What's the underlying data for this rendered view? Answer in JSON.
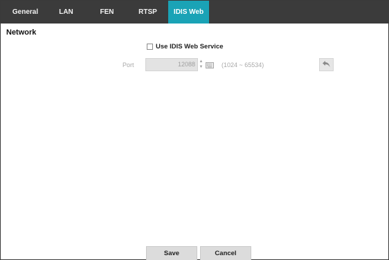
{
  "tabs": [
    {
      "label": "General",
      "active": false
    },
    {
      "label": "LAN",
      "active": false
    },
    {
      "label": "FEN",
      "active": false
    },
    {
      "label": "RTSP",
      "active": false
    },
    {
      "label": "IDIS Web",
      "active": true
    }
  ],
  "section": {
    "title": "Network"
  },
  "web_service": {
    "checkbox_label": "Use IDIS Web Service",
    "checked": false
  },
  "port": {
    "label": "Port",
    "value": "12088",
    "range": "(1024 ~ 65534)"
  },
  "footer": {
    "save_label": "Save",
    "cancel_label": "Cancel"
  },
  "icons": {
    "spin_up": "spin-up-icon",
    "spin_down": "spin-down-icon",
    "keyboard": "keyboard-icon",
    "undo": "undo-icon"
  },
  "colors": {
    "tab_bar": "#3b3b3b",
    "active_tab": "#1aa3b6"
  }
}
